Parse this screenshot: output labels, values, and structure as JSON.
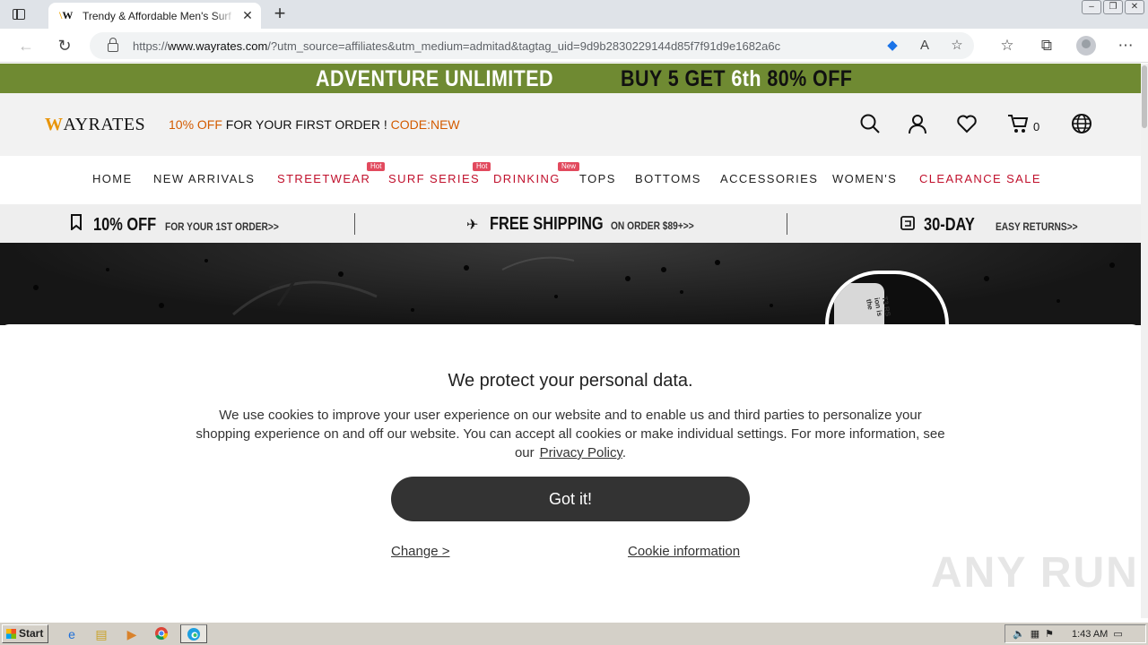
{
  "browser": {
    "tab_title": "Trendy & Affordable Men's Surf",
    "tab_favicon": "W",
    "url_prefix": "https://",
    "url_domain": "www.wayrates.com",
    "url_rest": "/?utm_source=affiliates&utm_medium=admitad&tagtag_uid=9d9b2830229144d85f7f91d9e1682a6c"
  },
  "promo": {
    "left": "ADVENTURE UNLIMITED",
    "right_a": "BUY 5 GET ",
    "right_b": "6th",
    "right_c": " 80% OFF"
  },
  "header": {
    "logo_w": "W",
    "logo_rest": "AYRATES",
    "offer_a": "10% OFF",
    "offer_b": " FOR YOUR FIRST ORDER ! ",
    "offer_c": "CODE:NEW",
    "cart_count": "0"
  },
  "nav": [
    {
      "label": "HOME"
    },
    {
      "label": "NEW ARRIVALS"
    },
    {
      "label": "STREETWEAR",
      "badge": "Hot"
    },
    {
      "label": "SURF SERIES",
      "badge": "Hot"
    },
    {
      "label": "DRINKING",
      "badge": "New"
    },
    {
      "label": "TOPS"
    },
    {
      "label": "BOTTOMS"
    },
    {
      "label": "ACCESSORIES"
    },
    {
      "label": "WOMEN'S"
    },
    {
      "label": "CLEARANCE SALE"
    }
  ],
  "benefits": [
    {
      "big": "10% OFF",
      "small": "FOR YOUR 1ST ORDER>>"
    },
    {
      "big": "FREE SHIPPING",
      "small": "ON ORDER $89+>>"
    },
    {
      "big": "30-DAY",
      "small": "EASY RETURNS>>"
    }
  ],
  "hero": {
    "shirt_text": "T3 RS\nion is\nthe"
  },
  "cookie": {
    "title": "We protect your personal data.",
    "text": "We use cookies to improve your user experience on our website and to enable us and third parties to personalize your shopping experience on and off our website. You can accept all cookies or make individual settings. For more information, see our",
    "policy_link": "Privacy Policy",
    "period": ".",
    "accept": "Got it!",
    "change": "Change >",
    "info": "Cookie information"
  },
  "watermark": "ANY RUN",
  "taskbar": {
    "start": "Start",
    "clock": "1:43 AM"
  },
  "colors": {
    "promo_bg": "#6f8a32",
    "accent_red": "#c0102c",
    "accent_orange": "#d35b00",
    "button_dark": "#333333"
  }
}
